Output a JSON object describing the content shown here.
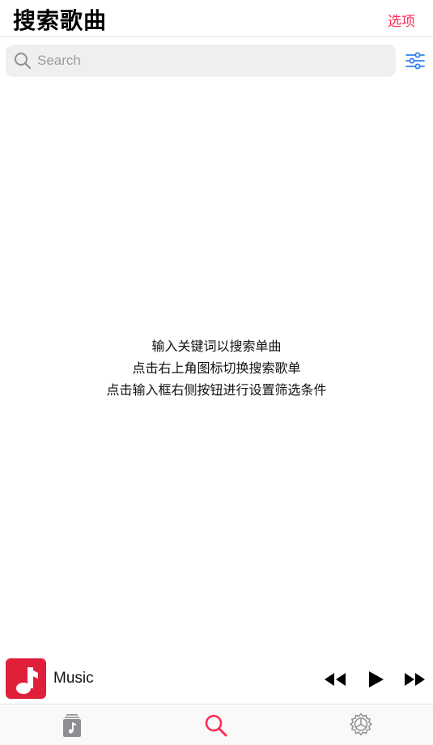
{
  "header": {
    "title": "搜索歌曲",
    "options_label": "选项"
  },
  "search": {
    "placeholder": "Search",
    "search_icon": "search-icon",
    "filter_icon": "sliders-icon"
  },
  "hint": {
    "lines": [
      "输入关键词以搜索单曲",
      "点击右上角图标切换搜索歌单",
      "点击输入框右侧按钮进行设置筛选条件"
    ]
  },
  "player": {
    "title": "Music",
    "album_icon": "music-note-icon",
    "controls": [
      "rewind-icon",
      "play-icon",
      "fast-forward-icon"
    ]
  },
  "tabs": [
    {
      "icon": "library-icon",
      "active": false
    },
    {
      "icon": "search-icon",
      "active": true
    },
    {
      "icon": "settings-gear-icon",
      "active": false
    }
  ],
  "colors": {
    "accent": "#ff2d55",
    "filter_icon": "#2f80ed",
    "album_background": "#e0203a",
    "inactive_tab": "#8e8e93",
    "search_field": "#efefef"
  }
}
